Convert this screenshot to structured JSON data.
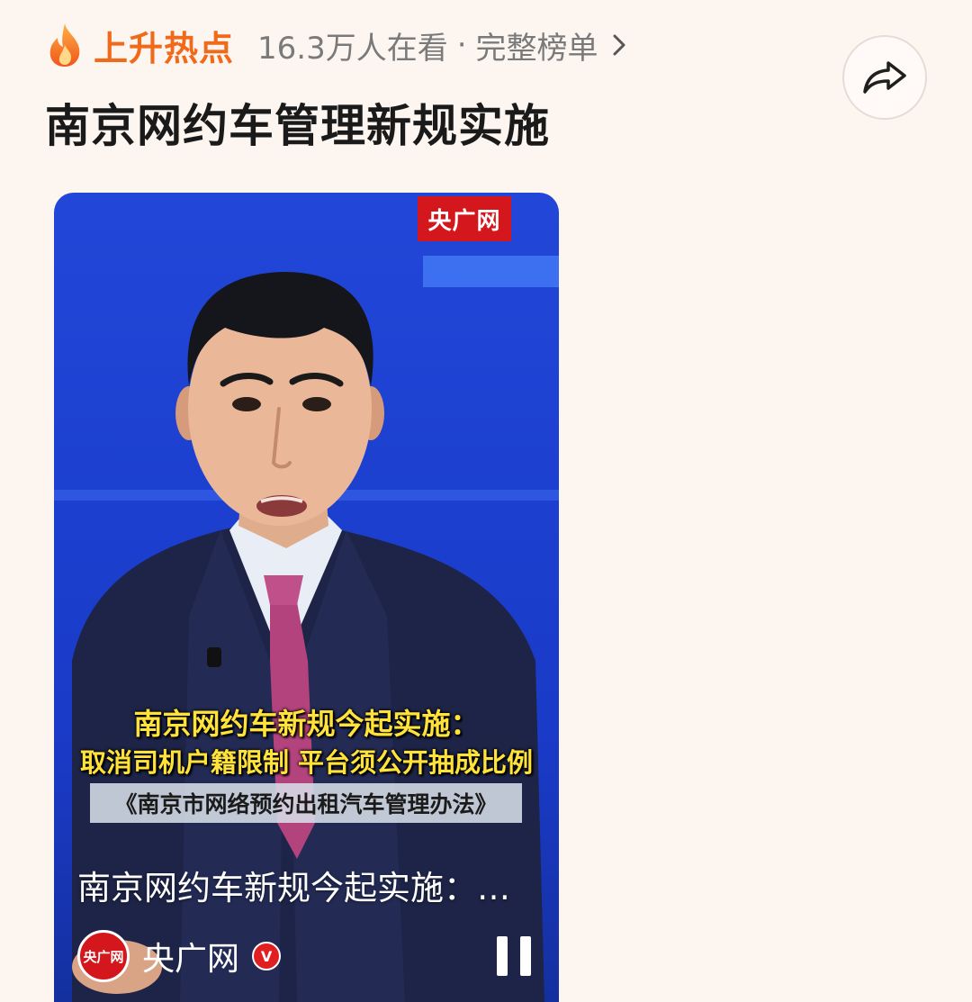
{
  "header": {
    "hot_label": "上升热点",
    "viewers": "16.3万人在看",
    "separator": "·",
    "full_list": "完整榜单",
    "title": "南京网约车管理新规实施",
    "icons": {
      "flame": "flame-icon",
      "chevron": "chevron-right-icon",
      "share": "share-icon"
    },
    "colors": {
      "hot": "#f06a1a",
      "muted": "#7a7a7a"
    }
  },
  "video": {
    "brand_badge": "央广网",
    "caption_line1": "南京网约车新规今起实施：",
    "caption_line2": "取消司机户籍限制 平台须公开抽成比例",
    "law_name": "《南京市网络预约出租汽车管理办法》",
    "title": "南京网约车新规今起实施：…",
    "source_name": "央广网",
    "source_avatar_text": "央广网",
    "verified_mark": "V",
    "state": "playing",
    "colors": {
      "studio_blue": "#1c3fcf",
      "brand_red": "#d4171c",
      "caption_yellow": "#ffe23a"
    }
  }
}
